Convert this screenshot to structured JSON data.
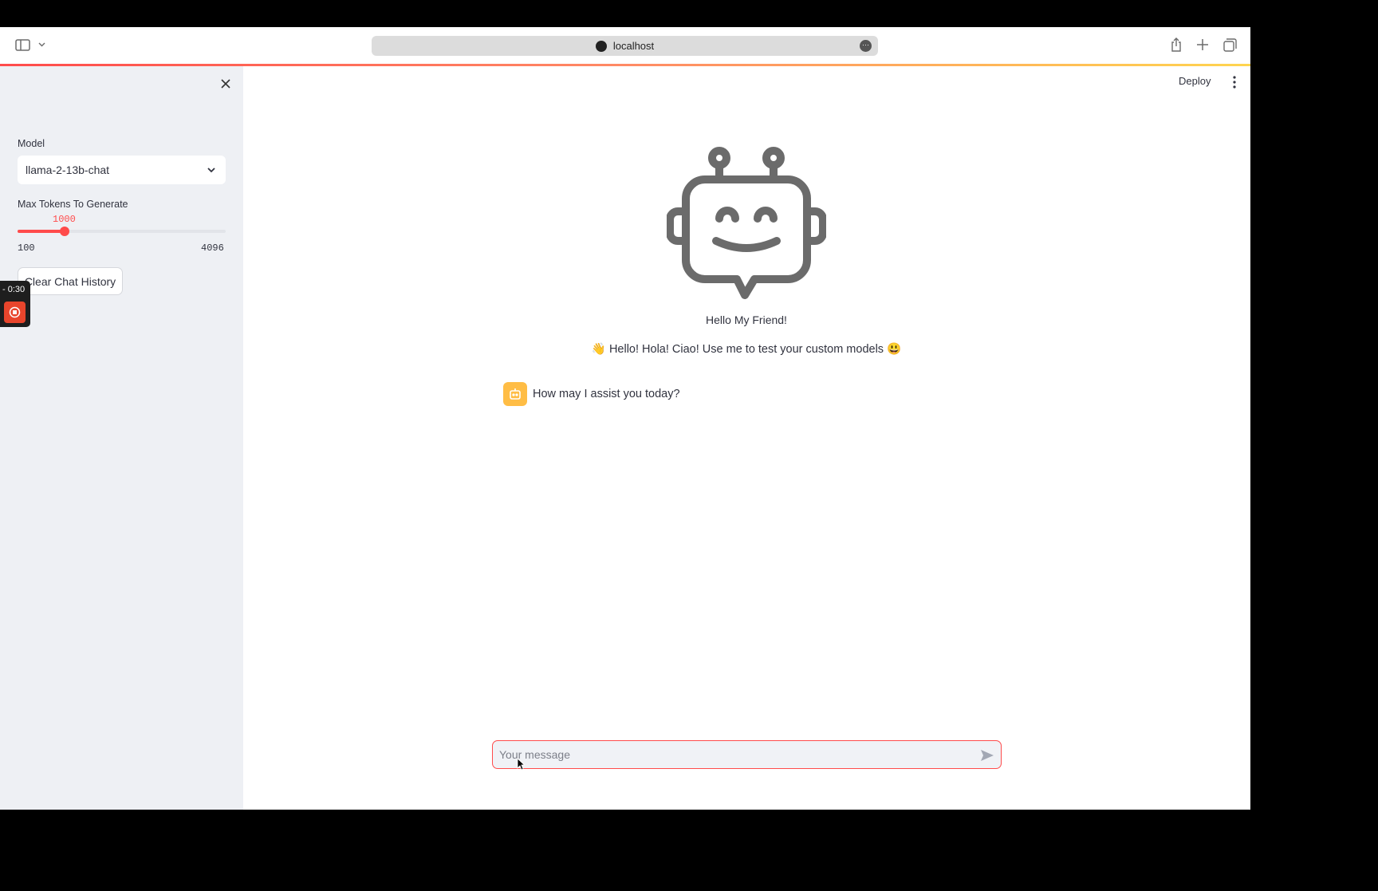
{
  "browser": {
    "url": "localhost",
    "more_label": "···"
  },
  "sidebar": {
    "model_label": "Model",
    "model_value": "llama-2-13b-chat",
    "max_tokens_label": "Max Tokens To Generate",
    "max_tokens_value": "1000",
    "max_tokens_min": "100",
    "max_tokens_max": "4096",
    "slider_fraction": 0.225,
    "clear_button_label": "Clear Chat History"
  },
  "recorder": {
    "time": "- 0:30"
  },
  "header": {
    "deploy_label": "Deploy"
  },
  "main": {
    "greeting": "Hello My Friend!",
    "tagline": "👋 Hello! Hola! Ciao! Use me to test your custom models 😃",
    "assistant_message": "How may I assist you today?"
  },
  "chat_input": {
    "placeholder": "Your message"
  },
  "colors": {
    "accent": "#ff4b4b",
    "sidebar_bg": "#eef0f4",
    "avatar_bg": "#ffbd45",
    "robot_gray": "#6b6b6b"
  },
  "icons": [
    "sidebar-toggle-icon",
    "chevron-down-icon",
    "share-icon",
    "plus-icon",
    "tabs-icon",
    "close-icon",
    "kebab-icon",
    "robot-icon",
    "bot-avatar-icon",
    "send-icon",
    "stop-icon"
  ]
}
